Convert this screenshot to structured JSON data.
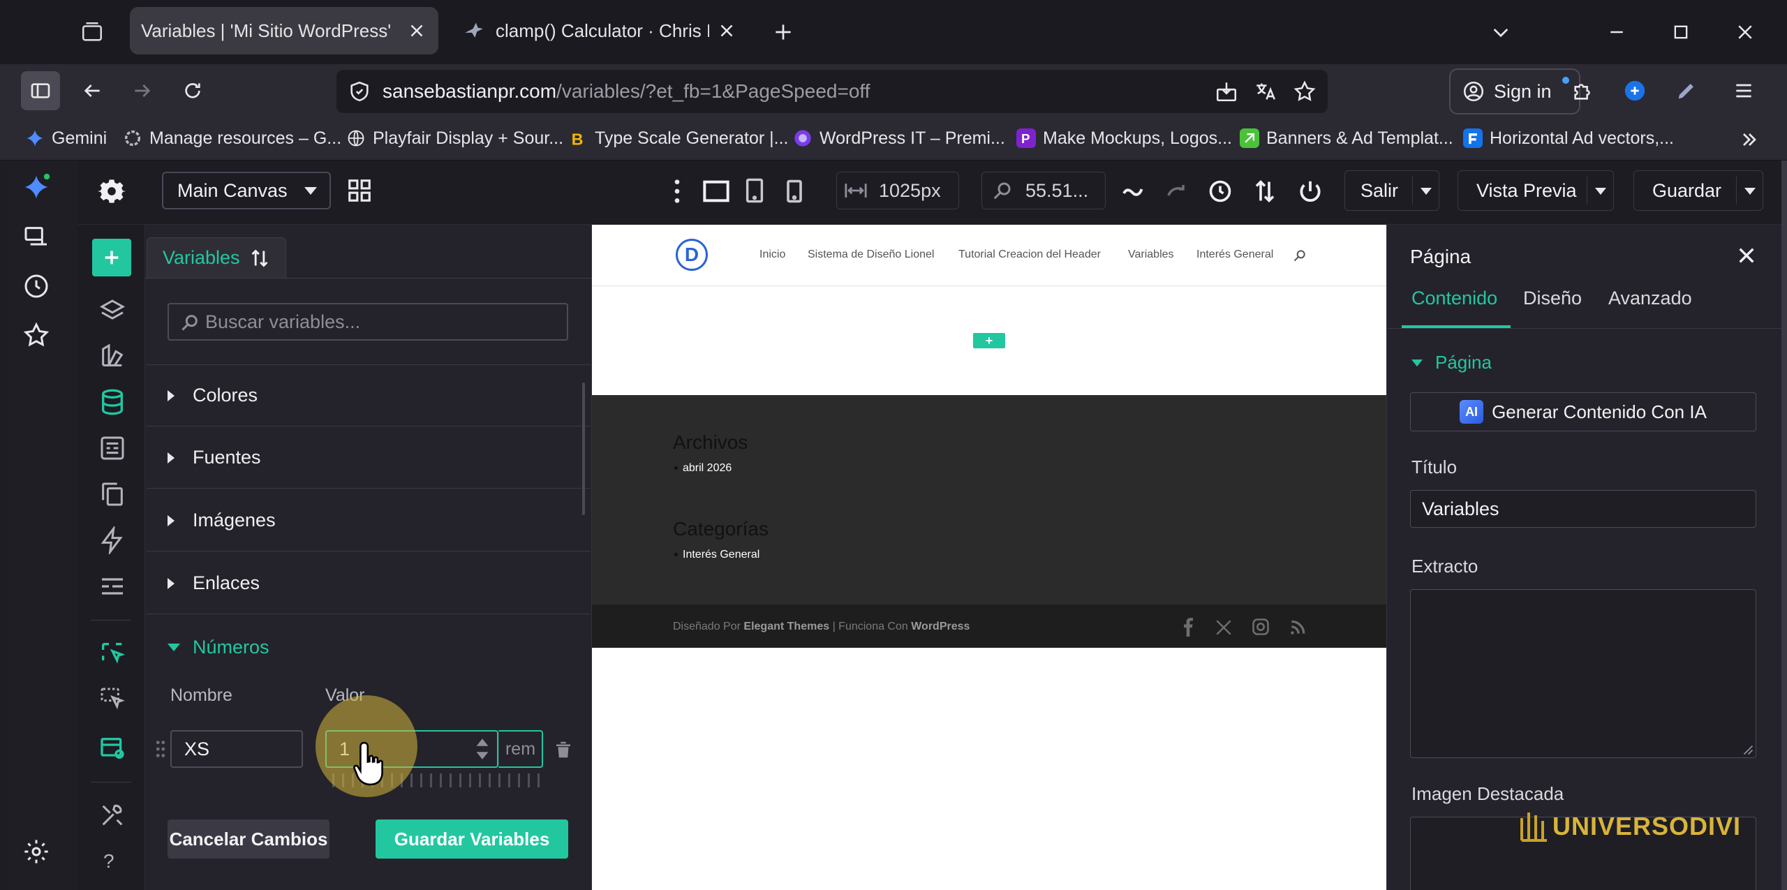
{
  "browser": {
    "tabs": [
      {
        "title": "Variables | 'Mi Sitio WordPress'",
        "active": true
      },
      {
        "title": "clamp() Calculator · Chris Burnell",
        "active": false
      }
    ],
    "url_domain": "sansebastianpr.com",
    "url_path": "/variables/?et_fb=1&PageSpeed=off",
    "signin_label": "Sign in",
    "bookmarks": [
      "Gemini",
      "Manage resources – G...",
      "Playfair Display + Sour...",
      "Type Scale Generator |...",
      "WordPress IT – Premi...",
      "Make Mockups, Logos...",
      "Banners & Ad Templat...",
      "Horizontal Ad vectors,..."
    ]
  },
  "builder": {
    "canvas_select": "Main Canvas",
    "width_value": "1025px",
    "zoom_value": "55.51...",
    "exit_label": "Salir",
    "preview_label": "Vista Previa",
    "save_label": "Guardar"
  },
  "variables_panel": {
    "tab_label": "Variables",
    "search_placeholder": "Buscar variables...",
    "sections": [
      "Colores",
      "Fuentes",
      "Imágenes",
      "Enlaces"
    ],
    "open_section": "Números",
    "col_name": "Nombre",
    "col_value": "Valor",
    "row": {
      "name": "XS",
      "value": "1",
      "unit": "rem"
    },
    "cancel_label": "Cancelar Cambios",
    "save_label": "Guardar Variables"
  },
  "site": {
    "logo_letter": "D",
    "nav": [
      "Inicio",
      "Sistema de Diseño Lionel",
      "Tutorial Creacion del Header",
      "Variables",
      "Interés General"
    ],
    "add_symbol": "+",
    "archives_title": "Archivos",
    "archives_item": "abril 2026",
    "categories_title": "Categorías",
    "categories_item": "Interés General",
    "footer_pre": "Diseñado Por",
    "footer_brand1": "Elegant Themes",
    "footer_mid": "| Funciona Con",
    "footer_brand2": "WordPress"
  },
  "settings_panel": {
    "title": "Página",
    "tabs": [
      "Contenido",
      "Diseño",
      "Avanzado"
    ],
    "section": "Página",
    "ai_button": "Generar Contenido Con IA",
    "ai_badge": "AI",
    "title_label": "Título",
    "title_value": "Variables",
    "excerpt_label": "Extracto",
    "featured_label": "Imagen Destacada"
  },
  "watermark": "UNIVERSODIVI",
  "colors": {
    "accent": "#22c7a0",
    "chrome_bg": "#2b2a33",
    "panel_bg": "#24232b"
  }
}
